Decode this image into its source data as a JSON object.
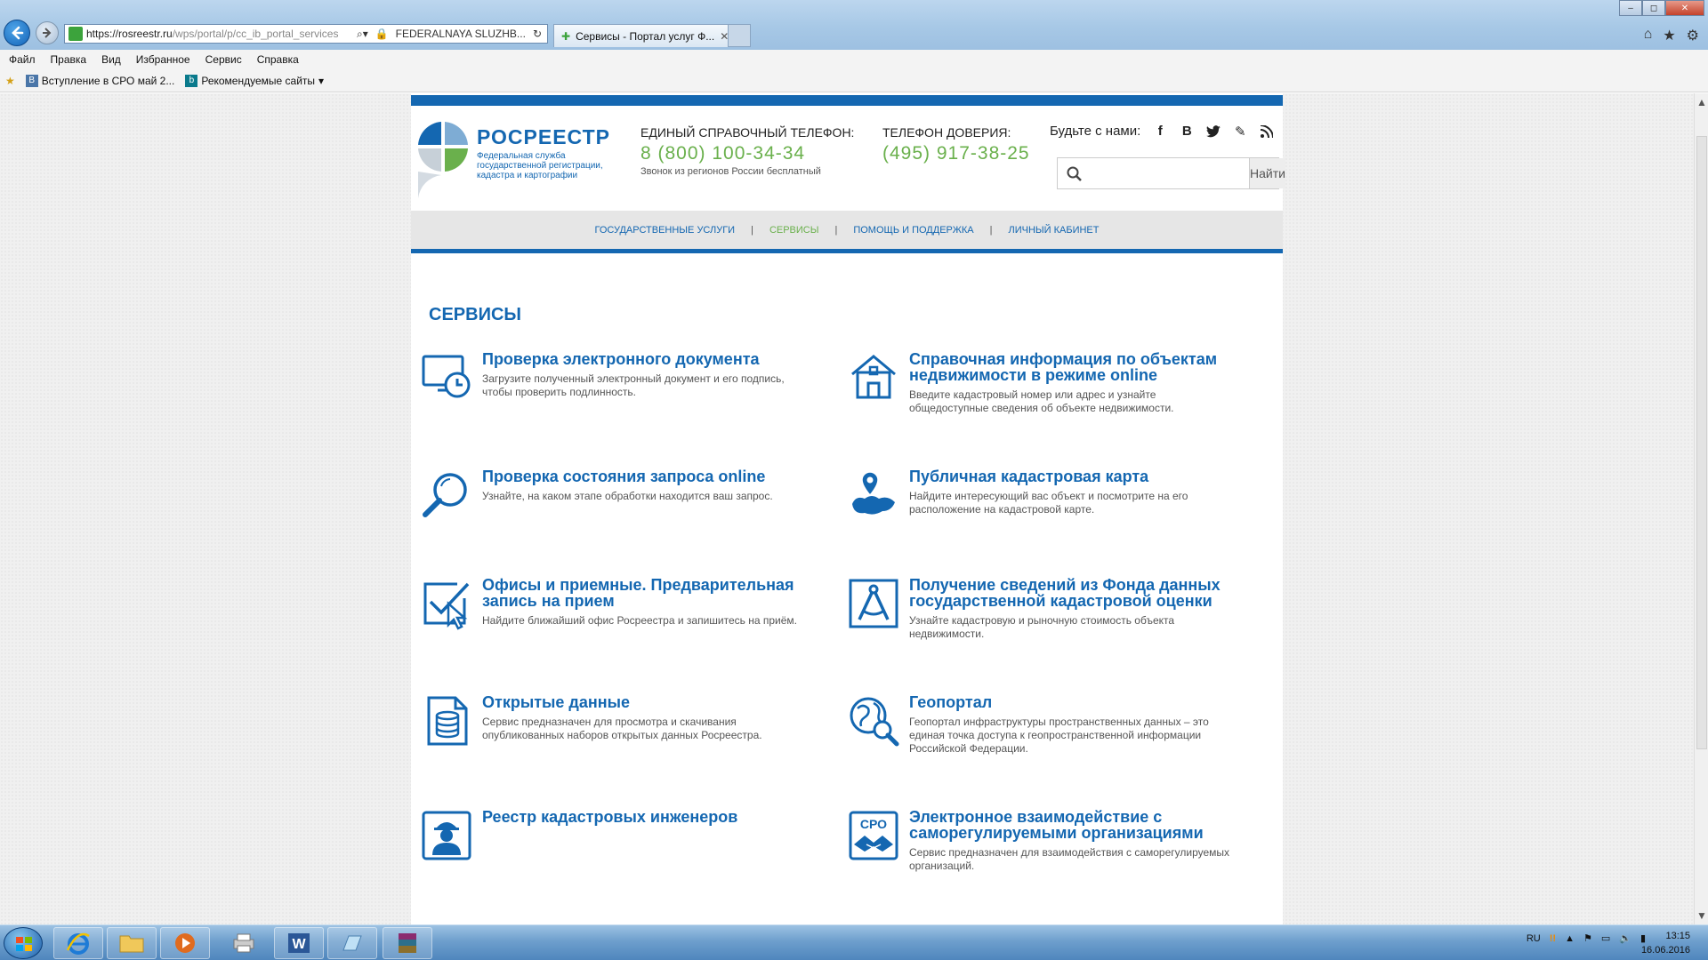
{
  "browser": {
    "url_host": "https://rosreestr.ru",
    "url_path": "/wps/portal/p/cc_ib_portal_services",
    "cert_label": "FEDERALNAYA SLUZHB...",
    "tab_title": "Сервисы - Портал услуг Ф...",
    "menu": [
      "Файл",
      "Правка",
      "Вид",
      "Избранное",
      "Сервис",
      "Справка"
    ],
    "favorites": [
      "Вступление в СРО май 2...",
      "Рекомендуемые сайты"
    ]
  },
  "header": {
    "logo_title": "РОСРЕЕСТР",
    "logo_subtitle": "Федеральная служба государственной регистрации, кадастра и картографии",
    "phone_label": "ЕДИНЫЙ СПРАВОЧНЫЙ ТЕЛЕФОН:",
    "phone_number": "8 (800) 100-34-34",
    "phone_note": "Звонок из регионов России бесплатный",
    "trust_label": "ТЕЛЕФОН ДОВЕРИЯ:",
    "trust_number": "(495) 917-38-25",
    "social_label": "Будьте с нами:",
    "search_placeholder": "",
    "search_button": "Найти"
  },
  "nav": {
    "items": [
      {
        "label": "ГОСУДАРСТВЕННЫЕ УСЛУГИ",
        "active": false
      },
      {
        "label": "СЕРВИСЫ",
        "active": true
      },
      {
        "label": "ПОМОЩЬ И ПОДДЕРЖКА",
        "active": false
      },
      {
        "label": "ЛИЧНЫЙ КАБИНЕТ",
        "active": false
      }
    ],
    "separator": "|"
  },
  "main": {
    "title": "СЕРВИСЫ",
    "services": [
      {
        "icon": "monitor-clock-icon",
        "title": "Проверка электронного документа",
        "desc": "Загрузите полученный электронный документ и его подпись, чтобы проверить подлинность."
      },
      {
        "icon": "house-icon",
        "title": "Справочная информация по объектам недвижимости в режиме online",
        "desc": "Введите кадастровый номер или адрес и узнайте общедоступные сведения об объекте недвижимости."
      },
      {
        "icon": "magnifier-icon",
        "title": "Проверка состояния запроса online",
        "desc": "Узнайте, на каком этапе обработки находится ваш запрос."
      },
      {
        "icon": "map-pin-icon",
        "title": "Публичная кадастровая карта",
        "desc": "Найдите интересующий вас объект и посмотрите на его расположение на кадастровой карте."
      },
      {
        "icon": "checkbox-cursor-icon",
        "title": "Офисы и приемные. Предварительная запись на прием",
        "desc": "Найдите ближайший офис Росреестра и запишитесь на приём."
      },
      {
        "icon": "compass-icon",
        "title": "Получение сведений из Фонда данных государственной кадастровой оценки",
        "desc": "Узнайте кадастровую и рыночную стоимость объекта недвижимости."
      },
      {
        "icon": "database-document-icon",
        "title": "Открытые данные",
        "desc": "Сервис предназначен для просмотра и скачивания опубликованных наборов открытых данных Росреестра."
      },
      {
        "icon": "globe-magnifier-icon",
        "title": "Геопортал",
        "desc": "Геопортал инфраструктуры пространственных данных – это единая точка доступа к геопространственной информации Российской Федерации."
      },
      {
        "icon": "engineer-icon",
        "title": "Реестр кадастровых инженеров",
        "desc": ""
      },
      {
        "icon": "sro-handshake-icon",
        "title": "Электронное взаимодействие с саморегулируемыми организациями",
        "desc": "Сервис предназначен для взаимодействия с саморегулируемых организаций.",
        "badge": "СРО"
      }
    ]
  },
  "taskbar": {
    "lang": "RU",
    "time": "13:15",
    "date": "16.06.2016"
  },
  "colors": {
    "brand_blue": "#1467b1",
    "brand_green": "#6ab04c"
  }
}
